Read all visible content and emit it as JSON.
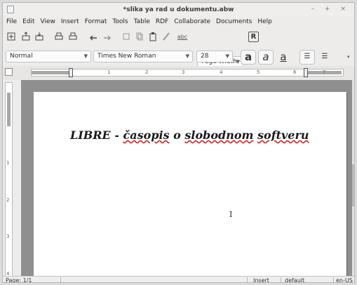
{
  "window": {
    "title": "*slika ya rad u dokumentu.abw",
    "controls": "– + ×"
  },
  "menu": [
    "File",
    "Edit",
    "View",
    "Insert",
    "Format",
    "Tools",
    "Table",
    "RDF",
    "Collaborate",
    "Documents",
    "Help"
  ],
  "toolbar": {
    "zoom": "Page Width",
    "spell_label": "abc"
  },
  "format": {
    "style": "Normal",
    "font": "Times New Roman",
    "size": "28",
    "bold_glyph": "a",
    "italic_glyph": "a",
    "underline_glyph": "a"
  },
  "ruler": {
    "h_numbers": [
      "1",
      "2",
      "3",
      "4",
      "5",
      "6",
      "7"
    ],
    "v_numbers": [
      "1",
      "2",
      "3",
      "4"
    ]
  },
  "document": {
    "text_prefix": "LIBRE - ",
    "text_word1": "časopis",
    "text_mid": " o ",
    "text_word2": "slobodnom",
    "text_space": " ",
    "text_word3": "softveru"
  },
  "status": {
    "page": "Page: 1/1",
    "mode": "Insert",
    "style": "default",
    "lang": "en-US"
  }
}
